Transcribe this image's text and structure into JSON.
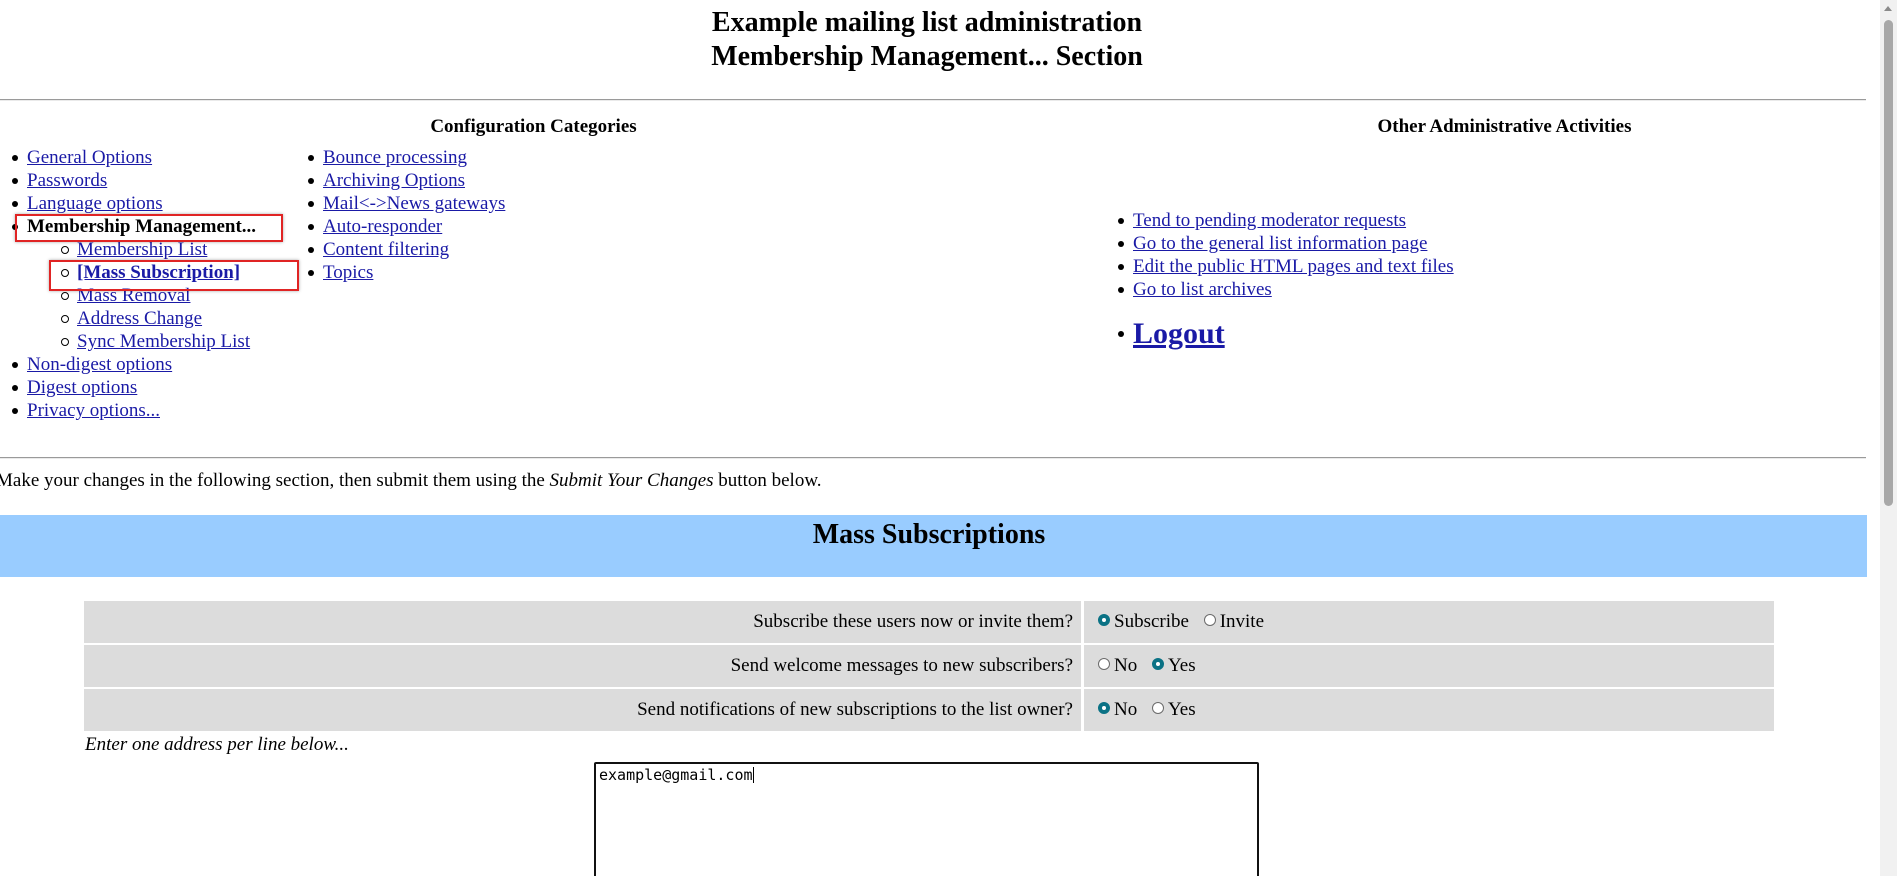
{
  "header": {
    "line1": "Example mailing list administration",
    "line2": "Membership Management... Section"
  },
  "config": {
    "title": "Configuration Categories",
    "col1": [
      {
        "label": "General Options"
      },
      {
        "label": "Passwords"
      },
      {
        "label": "Language options"
      },
      {
        "label": "Membership Management..."
      },
      {
        "label": "Membership List"
      },
      {
        "label": "[Mass Subscription]"
      },
      {
        "label": "Mass Removal"
      },
      {
        "label": "Address Change"
      },
      {
        "label": "Sync Membership List"
      },
      {
        "label": "Non-digest options"
      },
      {
        "label": "Digest options"
      },
      {
        "label": "Privacy options..."
      }
    ],
    "col2": [
      {
        "label": "Bounce processing"
      },
      {
        "label": "Archiving Options"
      },
      {
        "label": "Mail<->News gateways"
      },
      {
        "label": "Auto-responder"
      },
      {
        "label": "Content filtering"
      },
      {
        "label": "Topics"
      }
    ]
  },
  "other": {
    "title": "Other Administrative Activities",
    "items": [
      {
        "label": "Tend to pending moderator requests"
      },
      {
        "label": "Go to the general list information page"
      },
      {
        "label": "Edit the public HTML pages and text files"
      },
      {
        "label": "Go to list archives"
      }
    ],
    "logout": "Logout"
  },
  "intro": {
    "before": "Make your changes in the following section, then submit them using the ",
    "emphasis": "Submit Your Changes",
    "after": " button below."
  },
  "section": {
    "title": "Mass Subscriptions",
    "options": [
      {
        "question": "Subscribe these users now or invite them?",
        "choices": [
          {
            "label": "Subscribe",
            "selected": true
          },
          {
            "label": "Invite",
            "selected": false
          }
        ]
      },
      {
        "question": "Send welcome messages to new subscribers?",
        "choices": [
          {
            "label": "No",
            "selected": false
          },
          {
            "label": "Yes",
            "selected": true
          }
        ]
      },
      {
        "question": "Send notifications of new subscriptions to the list owner?",
        "choices": [
          {
            "label": "No",
            "selected": true
          },
          {
            "label": "Yes",
            "selected": false
          }
        ]
      }
    ],
    "enter_label": "Enter one address per line below...",
    "addresses": "example@gmail.com"
  },
  "colors": {
    "banner": "#99ccff",
    "row_bg": "#dcdcdc",
    "link": "#1a1aa6",
    "highlight": "#e02424"
  }
}
